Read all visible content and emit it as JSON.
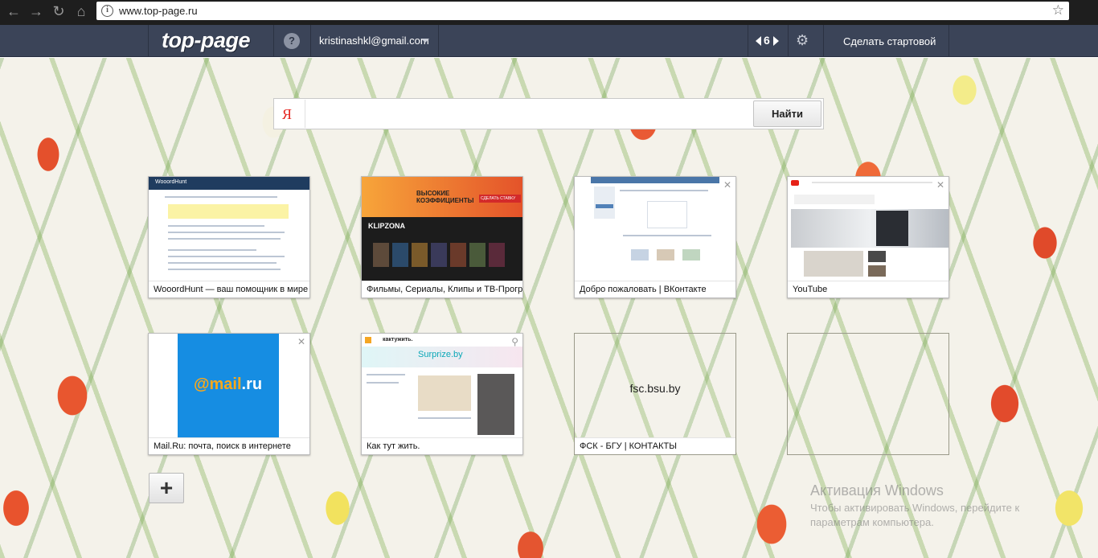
{
  "browser": {
    "url": "www.top-page.ru",
    "icons": [
      "back-icon",
      "forward-icon",
      "reload-icon",
      "home-icon",
      "info-icon",
      "bookmark-star-icon"
    ]
  },
  "header": {
    "logo": "top-page",
    "help": "?",
    "email": "kristinashkl@gmail.com",
    "page_number": "6",
    "make_start": "Сделать стартовой"
  },
  "search": {
    "engine_letter": "Я",
    "placeholder": "",
    "button": "Найти"
  },
  "tiles": [
    {
      "title": "WooordHunt — ваш помощник в мире английского языка",
      "thumb_title": "WooordHunt"
    },
    {
      "title": "Фильмы, Сериалы, Клипы и ТВ-Программы",
      "thumb_banner": "ВЫСОКИЕ КОЭФФИЦИЕНТЫ",
      "thumb_cta": "СДЕЛАТЬ СТАВКУ",
      "thumb_brand": "KLIPZONA"
    },
    {
      "title": "Добро пожаловать | ВКонтакте"
    },
    {
      "title": "YouTube"
    },
    {
      "title": "Mail.Ru: почта, поиск в интернете",
      "thumb_logo_at": "@mail",
      "thumb_logo_ru": ".ru"
    },
    {
      "title": "Как тут жить.",
      "thumb_brand": "кактужить.",
      "thumb_surprize": "Surprize.by"
    },
    {
      "title": "ФСК - БГУ | КОНТАКТЫ",
      "center_text": "fsc.bsu.by"
    },
    {
      "title": ""
    }
  ],
  "add_button": "+",
  "watermark": {
    "title": "Активация Windows",
    "text": "Чтобы активировать Windows, перейдите к параметрам компьютера."
  },
  "colors": {
    "header_bg": "#3b4458",
    "mail_blue": "#168de2",
    "yandex_red": "#e52620"
  }
}
